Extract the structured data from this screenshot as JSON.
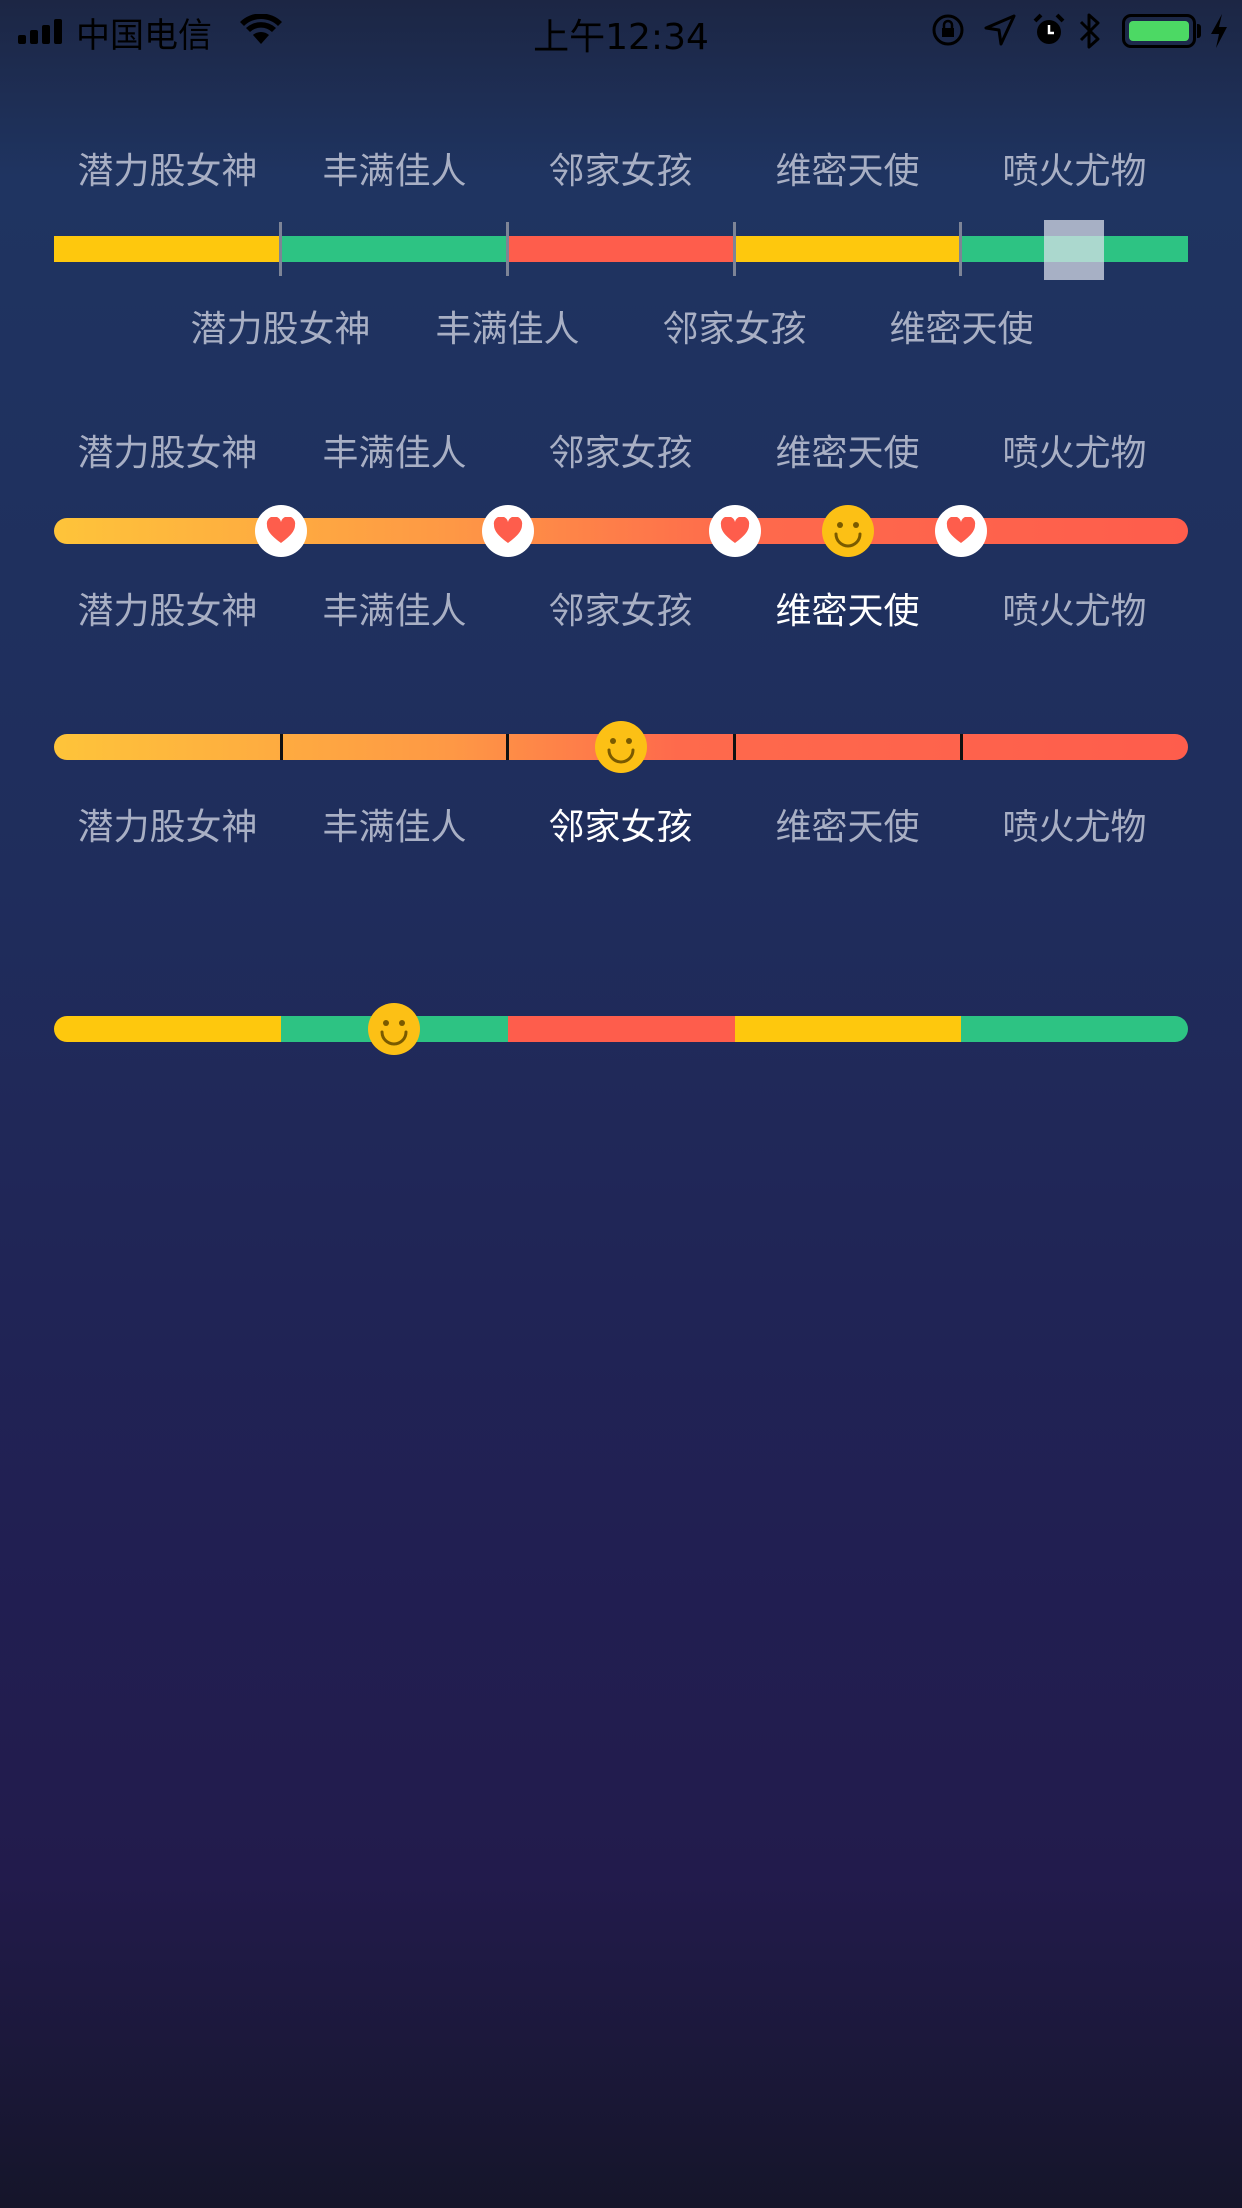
{
  "status_bar": {
    "carrier": "中国电信",
    "time": "上午12:34"
  },
  "colors": {
    "yellow": "#fec80d",
    "green": "#2dc383",
    "red": "#fe5d4c",
    "label": "#a8afc4",
    "label_active": "#ffffff"
  },
  "labels": [
    "潜力股女神",
    "丰满佳人",
    "邻家女孩",
    "维密天使",
    "喷火尤物"
  ],
  "slider1": {
    "top_labels": [
      "潜力股女神",
      "丰满佳人",
      "邻家女孩",
      "维密天使",
      "喷火尤物"
    ],
    "bottom_labels": [
      "潜力股女神",
      "丰满佳人",
      "邻家女孩",
      "维密天使"
    ],
    "segment_colors": [
      "yellow",
      "green",
      "red",
      "yellow",
      "green"
    ],
    "selected_segment": 5
  },
  "slider2": {
    "top_labels": [
      "潜力股女神",
      "丰满佳人",
      "邻家女孩",
      "维密天使",
      "喷火尤物"
    ],
    "bottom_labels": [
      "潜力股女神",
      "丰满佳人",
      "邻家女孩",
      "维密天使",
      "喷火尤物"
    ],
    "active_label": "维密天使",
    "thumb_value": 0.7,
    "knob_icons": [
      "heart-icon",
      "heart-icon",
      "heart-icon",
      "heart-icon"
    ]
  },
  "slider3": {
    "labels": [
      "潜力股女神",
      "丰满佳人",
      "邻家女孩",
      "维密天使",
      "喷火尤物"
    ],
    "active_label": "邻家女孩",
    "thumb_value": 0.5
  },
  "slider4": {
    "segment_colors": [
      "yellow",
      "green",
      "red",
      "yellow",
      "green"
    ],
    "thumb_value": 0.3
  }
}
